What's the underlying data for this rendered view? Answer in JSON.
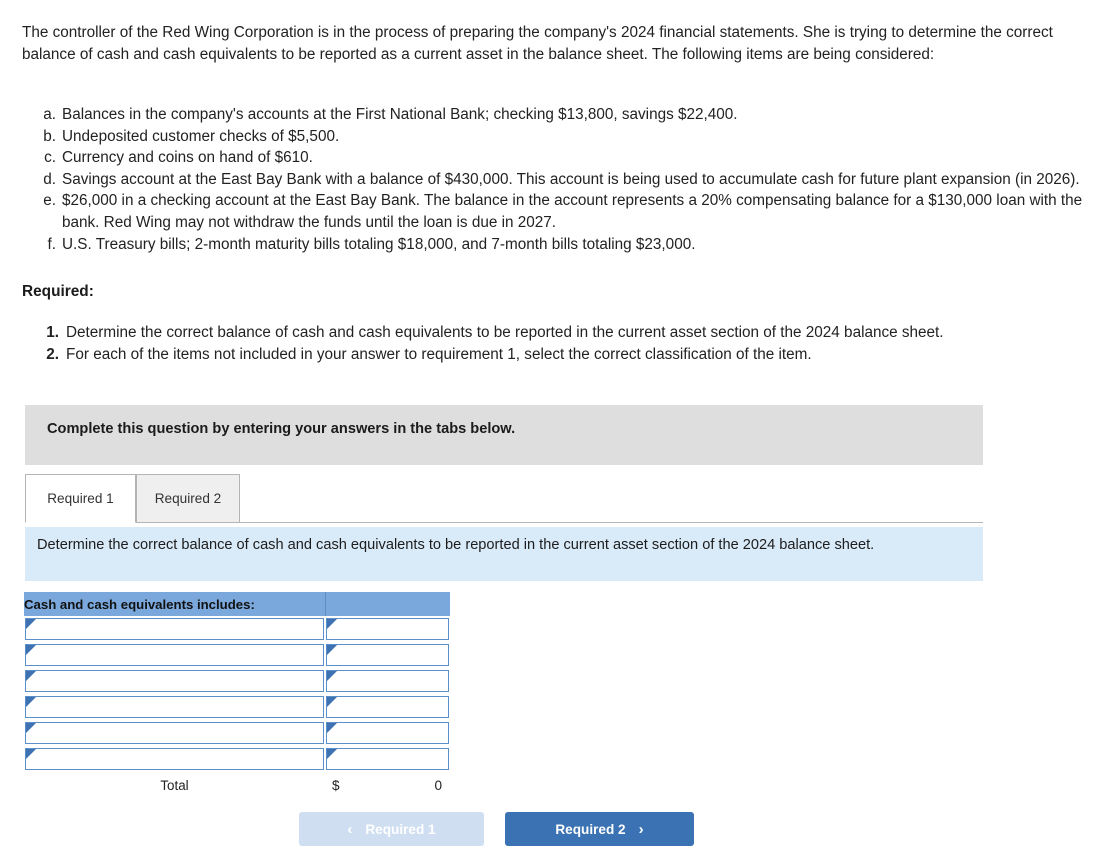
{
  "intro": "The controller of the Red Wing Corporation is in the process of preparing the company's 2024 financial statements. She is trying to determine the correct balance of cash and cash equivalents to be reported as a current asset in the balance sheet. The following items are being considered:",
  "items": [
    {
      "marker": "a.",
      "text": "Balances in the company's accounts at the First National Bank; checking $13,800, savings $22,400."
    },
    {
      "marker": "b.",
      "text": "Undeposited customer checks of $5,500."
    },
    {
      "marker": "c.",
      "text": "Currency and coins on hand of $610."
    },
    {
      "marker": "d.",
      "text": "Savings account at the East Bay Bank with a balance of $430,000. This account is being used to accumulate cash for future plant expansion (in 2026)."
    },
    {
      "marker": "e.",
      "text": "$26,000 in a checking account at the East Bay Bank. The balance in the account represents a 20% compensating balance for a $130,000 loan with the bank. Red Wing may not withdraw the funds until the loan is due in 2027."
    },
    {
      "marker": "f.",
      "text": "U.S. Treasury bills; 2-month maturity bills totaling $18,000, and 7-month bills totaling $23,000."
    }
  ],
  "required_heading": "Required:",
  "requirements": [
    {
      "num": "1.",
      "text": "Determine the correct balance of cash and cash equivalents to be reported in the current asset section of the 2024 balance sheet."
    },
    {
      "num": "2.",
      "text": "For each of the items not included in your answer to requirement 1, select the correct classification of the item."
    }
  ],
  "banner": {
    "text": "Complete this question by entering your answers in the tabs below."
  },
  "tabs": [
    {
      "label": "Required 1",
      "active": true
    },
    {
      "label": "Required 2",
      "active": false
    }
  ],
  "infobox": {
    "text": "Determine the correct balance of cash and cash equivalents to be reported in the current asset section of the 2024 balance sheet."
  },
  "answer_table": {
    "header_label": "Cash and cash equivalents includes:",
    "header_value": "",
    "rows": [
      {
        "label": "",
        "value": ""
      },
      {
        "label": "",
        "value": ""
      },
      {
        "label": "",
        "value": ""
      },
      {
        "label": "",
        "value": ""
      },
      {
        "label": "",
        "value": ""
      },
      {
        "label": "",
        "value": ""
      }
    ],
    "total_label": "Total",
    "total_currency": "$",
    "total_value": "0"
  },
  "nav": {
    "prev_label": "Required 1",
    "prev_chevron": "‹",
    "next_label": "Required 2",
    "next_chevron": "›"
  },
  "colors": {
    "header_blue": "#7aa8dc",
    "cell_border_blue": "#5b8fc9",
    "info_blue": "#d9eaf8",
    "banner_gray": "#dedede",
    "button_active": "#3a72b3",
    "button_disabled": "#cfdef0"
  }
}
